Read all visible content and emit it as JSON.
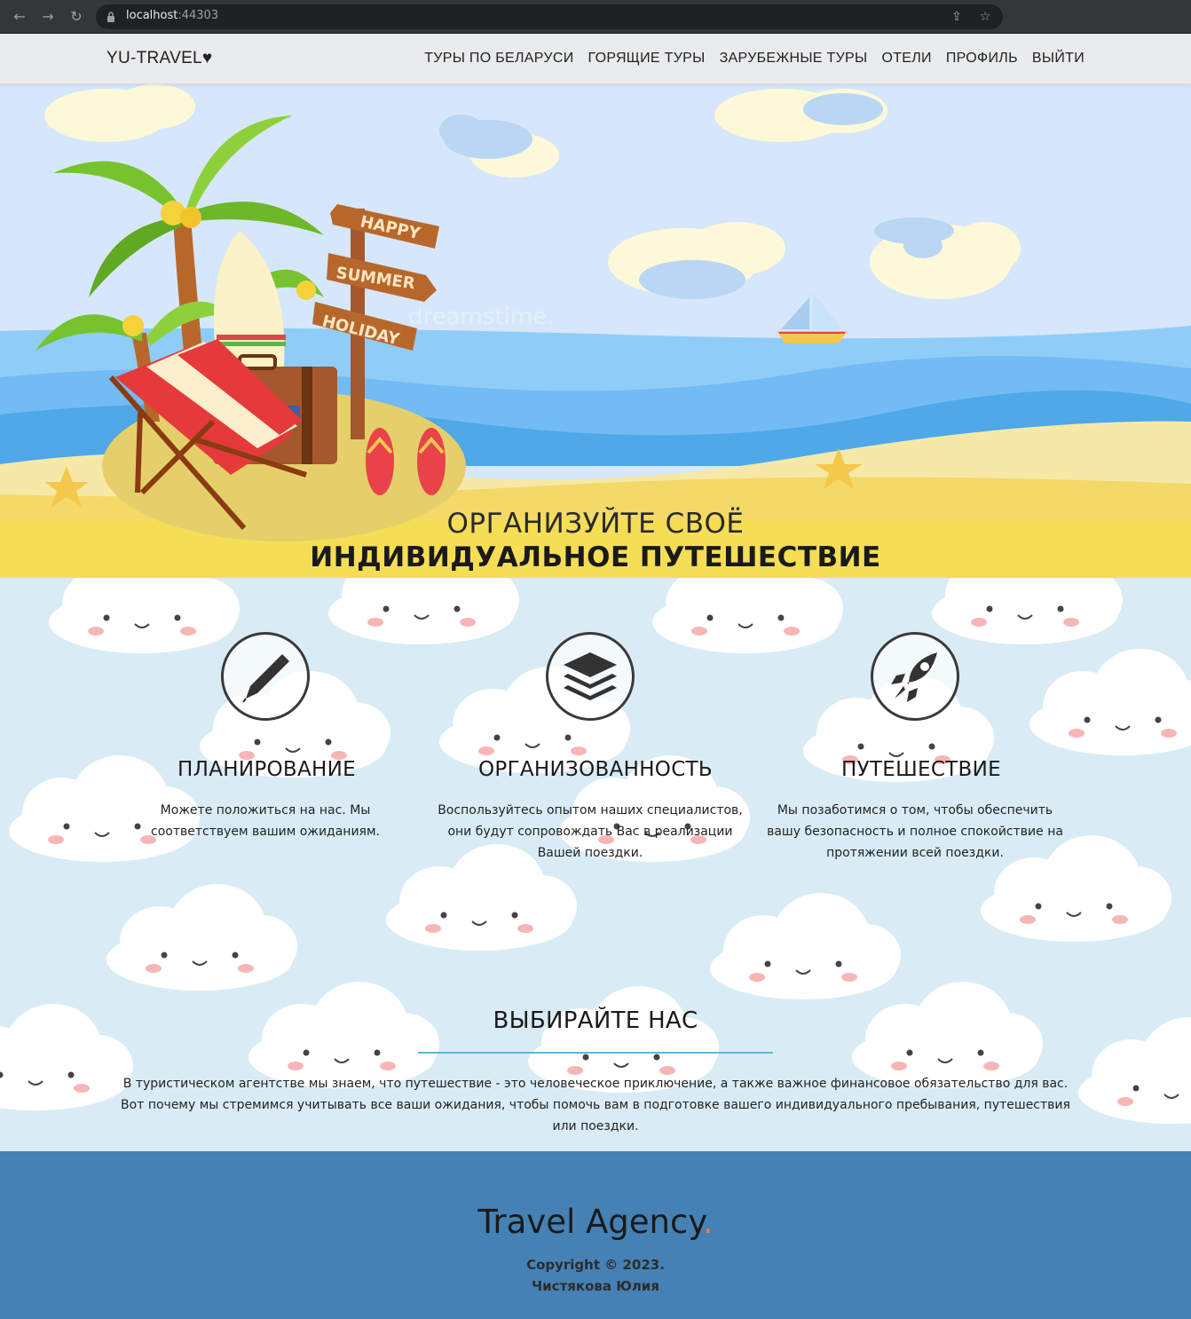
{
  "browser": {
    "url_host": "localhost",
    "url_port": ":44303"
  },
  "navbar": {
    "brand": "YU-TRAVEL♥",
    "links": [
      "ТУРЫ ПО БЕЛАРУСИ",
      "ГОРЯЩИЕ ТУРЫ",
      "ЗАРУБЕЖНЫЕ ТУРЫ",
      "ОТЕЛИ",
      "ПРОФИЛЬ",
      "ВЫЙТИ"
    ]
  },
  "hero": {
    "title_line1": "ОРГАНИЗУЙТЕ СВОЁ",
    "title_line2": "ИНДИВИДУАЛЬНОЕ ПУТЕШЕСТВИЕ",
    "sign_texts": [
      "HAPPY",
      "SUMMER",
      "HOLIDAY"
    ],
    "watermark": "dreamstime."
  },
  "features": [
    {
      "icon": "pen-icon",
      "title": "ПЛАНИРОВАНИЕ",
      "text": "Можете положиться на нас. Мы соответствуем вашим ожиданиям."
    },
    {
      "icon": "layers-icon",
      "title": "ОРГАНИЗОВАННОСТЬ",
      "text": "Воспользуйтесь опытом наших специалистов, они будут сопровождать Вас в реализации Вашей поездки."
    },
    {
      "icon": "rocket-icon",
      "title": "ПУТЕШЕСТВИЕ",
      "text": "Мы позаботимся о том, чтобы обеспечить вашу безопасность и полное спокойствие на протяжении всей поездки."
    }
  ],
  "why": {
    "title": "ВЫБИРАЙТЕ НАС",
    "text": "В туристическом агентстве мы знаем, что путешествие - это человеческое приключение, а также важное финансовое обязательство для вас. Вот почему мы стремимся учитывать все ваши ожидания, чтобы помочь вам в подготовке вашего индивидуального пребывания, путешествия или поездки."
  },
  "footer": {
    "logo_text": "Travel Agency",
    "logo_dot": ".",
    "copyright": "Copyright © 2023.",
    "author": "Чистякова Юлия"
  },
  "colors": {
    "navbar_bg": "#eaebec",
    "sky": "#d7e8fa",
    "sea": "#4fa8e8",
    "sand": "#f6e07a",
    "clouds_bg": "#d9ecf6",
    "rule": "#55bcd6",
    "footer_bg": "#4581b5",
    "accent_dot": "#ee7a2e"
  }
}
